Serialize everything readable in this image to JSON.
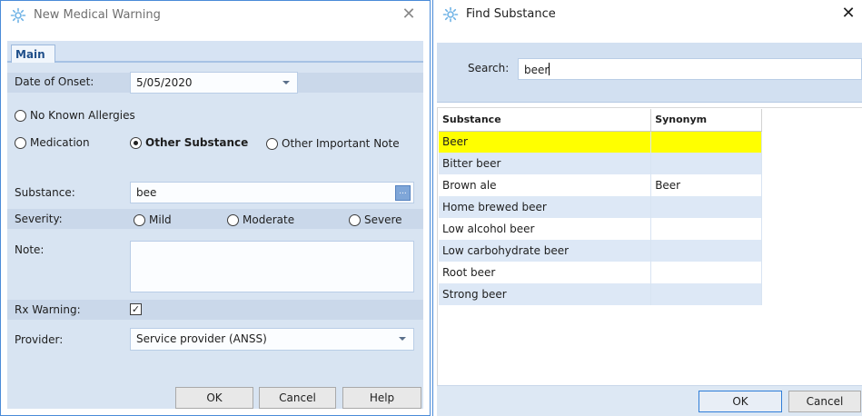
{
  "medical_warning": {
    "title": "New Medical Warning",
    "tab_main": "Main",
    "date_of_onset": {
      "label": "Date of Onset:",
      "value": "5/05/2020"
    },
    "radios_type": [
      {
        "label": "No Known Allergies",
        "checked": false
      },
      {
        "label": "Medication",
        "checked": false
      },
      {
        "label": "Other Substance",
        "checked": true
      },
      {
        "label": "Other Important Note",
        "checked": false
      }
    ],
    "substance": {
      "label": "Substance:",
      "value": "bee",
      "browse_label": "..."
    },
    "severity": {
      "label": "Severity:",
      "options": [
        {
          "label": "Mild",
          "checked": false
        },
        {
          "label": "Moderate",
          "checked": false
        },
        {
          "label": "Severe",
          "checked": false
        }
      ]
    },
    "note": {
      "label": "Note:",
      "value": ""
    },
    "rx_warning": {
      "label": "Rx Warning:",
      "checked": true
    },
    "provider": {
      "label": "Provider:",
      "value": "Service provider (ANSS)"
    },
    "buttons": {
      "ok": "OK",
      "cancel": "Cancel",
      "help": "Help"
    }
  },
  "find_substance": {
    "title": "Find Substance",
    "search": {
      "label": "Search:",
      "value": "beer"
    },
    "columns": [
      "Substance",
      "Synonym"
    ],
    "rows": [
      {
        "substance": "Beer",
        "synonym": "",
        "selected": true
      },
      {
        "substance": "Bitter beer",
        "synonym": ""
      },
      {
        "substance": "Brown ale",
        "synonym": "Beer"
      },
      {
        "substance": "Home brewed beer",
        "synonym": ""
      },
      {
        "substance": "Low alcohol beer",
        "synonym": ""
      },
      {
        "substance": "Low carbohydrate beer",
        "synonym": ""
      },
      {
        "substance": "Root beer",
        "synonym": ""
      },
      {
        "substance": "Strong beer",
        "synonym": ""
      }
    ],
    "buttons": {
      "ok": "OK",
      "cancel": "Cancel"
    }
  },
  "icons": {
    "app": "gear-icon",
    "close": "close-icon"
  },
  "colors": {
    "accent": "#2f7ed8",
    "panel": "#d8e4f2",
    "selected_row": "#ffff00"
  }
}
